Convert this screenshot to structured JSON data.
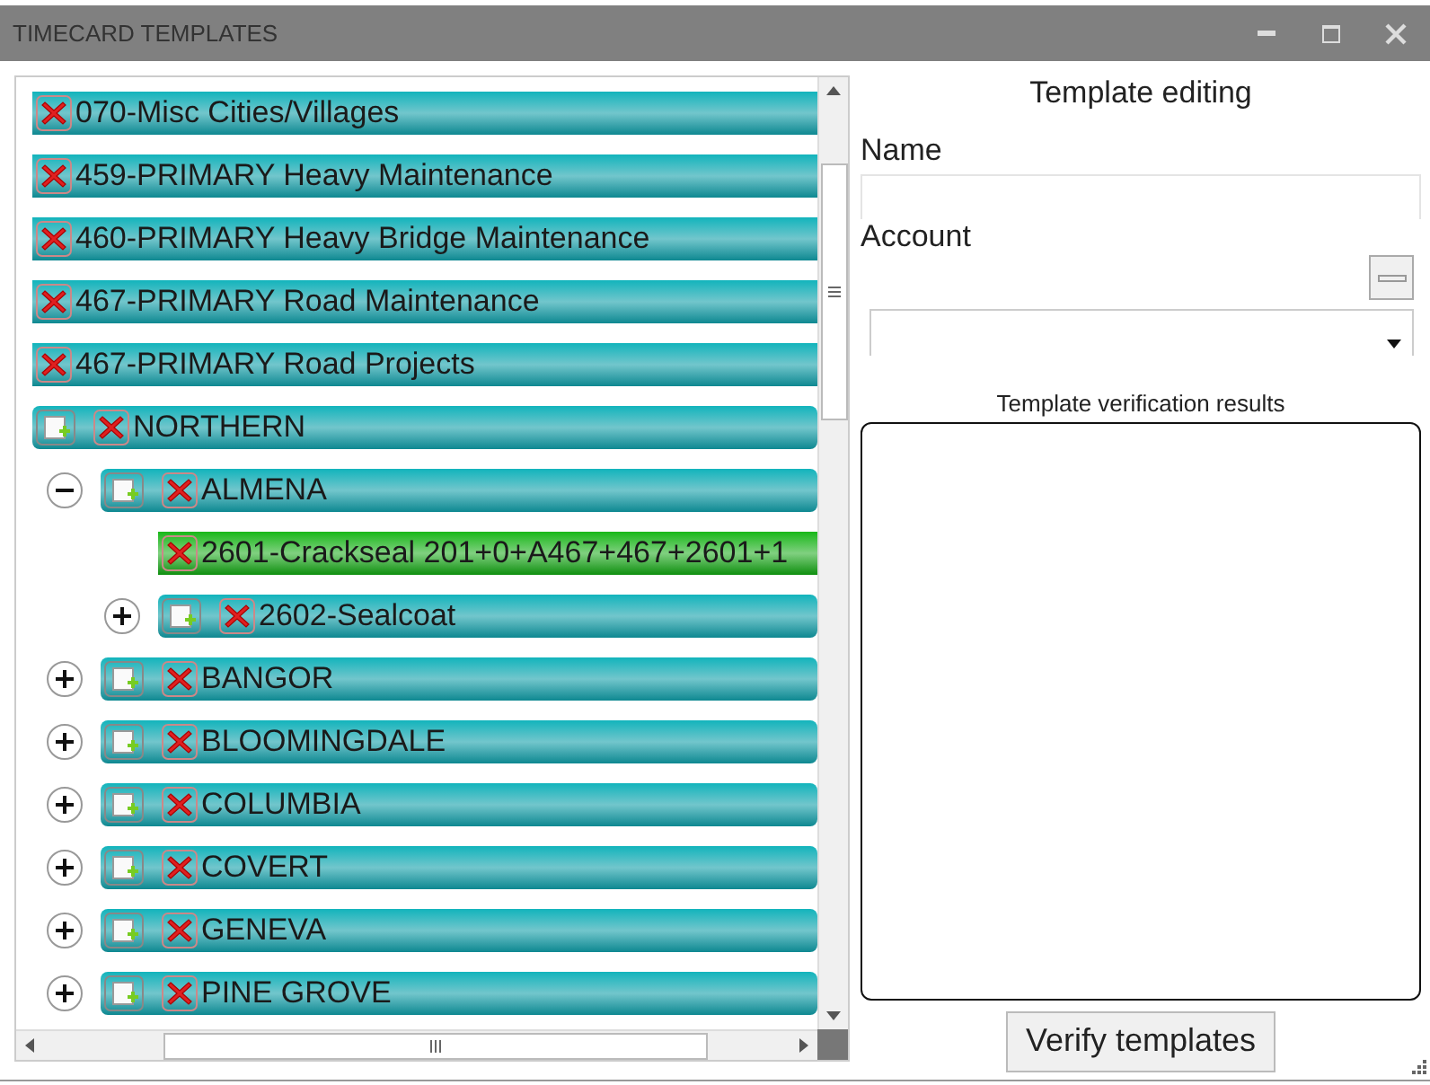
{
  "window": {
    "title": "TIMECARD TEMPLATES"
  },
  "tree": {
    "items": [
      {
        "kind": "template",
        "label": "070-Misc Cities/Villages",
        "selected": false
      },
      {
        "kind": "template",
        "label": "459-PRIMARY Heavy Maintenance",
        "selected": false
      },
      {
        "kind": "template",
        "label": "460-PRIMARY Heavy Bridge Maintenance",
        "selected": false
      },
      {
        "kind": "template",
        "label": "467-PRIMARY Road Maintenance",
        "selected": false
      },
      {
        "kind": "template",
        "label": "467-PRIMARY Road Projects",
        "selected": false
      },
      {
        "kind": "group",
        "label": "NORTHERN",
        "selected": false,
        "children": [
          {
            "kind": "group",
            "label": "ALMENA",
            "selected": false,
            "expanded": true,
            "children": [
              {
                "kind": "template",
                "label": "2601-Crackseal 201+0+A467+467+2601+1",
                "selected": true
              },
              {
                "kind": "group",
                "label": "2602-Sealcoat",
                "selected": false,
                "expanded": false
              }
            ]
          },
          {
            "kind": "group",
            "label": "BANGOR",
            "selected": false,
            "expanded": false
          },
          {
            "kind": "group",
            "label": "BLOOMINGDALE",
            "selected": false,
            "expanded": false
          },
          {
            "kind": "group",
            "label": "COLUMBIA",
            "selected": false,
            "expanded": false
          },
          {
            "kind": "group",
            "label": "COVERT",
            "selected": false,
            "expanded": false
          },
          {
            "kind": "group",
            "label": "GENEVA",
            "selected": false,
            "expanded": false
          },
          {
            "kind": "group",
            "label": "PINE GROVE",
            "selected": false,
            "expanded": false
          }
        ]
      }
    ]
  },
  "editor": {
    "title": "Template editing",
    "name_label": "Name",
    "account_label": "Account",
    "results_label": "Template verification results",
    "verify_button": "Verify templates"
  }
}
